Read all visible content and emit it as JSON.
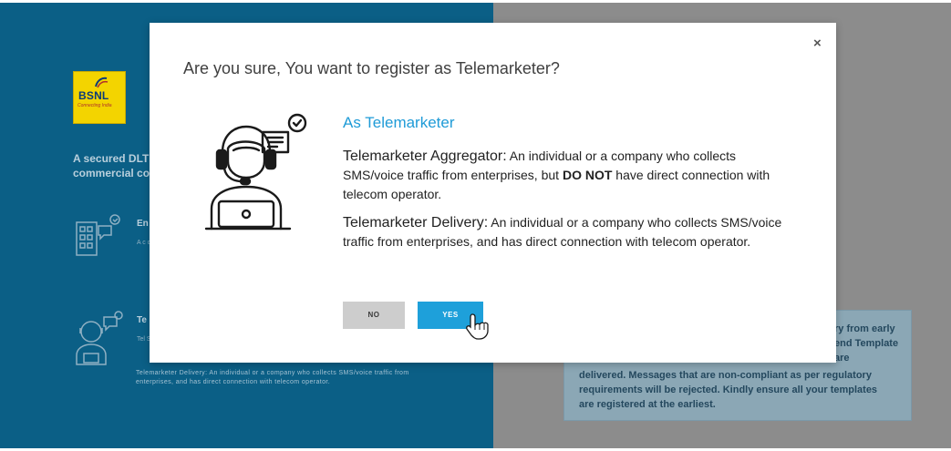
{
  "background": {
    "logo": {
      "text": "BSNL",
      "tagline": "Connecting India"
    },
    "heading": "A secured DLT commercial co",
    "section1": {
      "title": "En",
      "subtitle": "A c or thr"
    },
    "section2": {
      "title": "Te",
      "subtitle": "Tel SM wit"
    },
    "delivery_text": "Telemarketer Delivery: An individual or a company who collects SMS/voice traffic from enterprises, and has direct connection with telecom operator.",
    "info_box": {
      "right_text": "ry from early end Template are",
      "text": "delivered. Messages that are non-compliant as per regulatory requirements will be rejected. Kindly ensure all your templates are registered at the earliest."
    }
  },
  "modal": {
    "close_label": "×",
    "title": "Are you sure, You want to register as Telemarketer?",
    "section_title": "As Telemarketer",
    "aggregator": {
      "head": "Telemarketer Aggregator:",
      "text_pre": " An individual or a company who collects SMS/voice traffic from enterprises, but ",
      "bold": "DO NOT",
      "text_post": " have direct connection with telecom operator."
    },
    "delivery": {
      "head": "Telemarketer Delivery:",
      "text": " An individual or a company who collects SMS/voice traffic from enterprises, and has direct connection with telecom operator."
    },
    "buttons": {
      "no": "NO",
      "yes": "YES"
    }
  },
  "colors": {
    "accent": "#1ea0da",
    "left_panel": "#0b5f86",
    "overlay": "#8c8c8c"
  }
}
